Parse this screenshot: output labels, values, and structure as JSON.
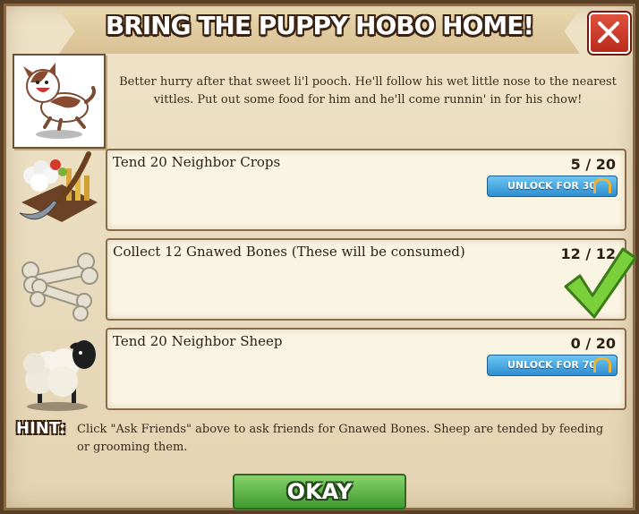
{
  "dialog": {
    "title": "BRING THE PUPPY HOBO HOME!",
    "intro": "Better hurry after that sweet li'l pooch.  He'll follow his wet little nose to the nearest vittles. Put out some food for him and he'll come runnin' in for his chow!",
    "close_icon": "close-x-icon"
  },
  "tasks": [
    {
      "label": "Tend 20 Neighbor Crops",
      "count": "5 / 20",
      "unlock_label": "UNLOCK FOR 30",
      "icon": "crops-scythe-icon",
      "complete": false
    },
    {
      "label": "Collect 12 Gnawed Bones (These will be consumed)",
      "count": "12 / 12",
      "unlock_label": "",
      "icon": "bones-icon",
      "complete": true
    },
    {
      "label": "Tend 20 Neighbor Sheep",
      "count": "0 / 20",
      "unlock_label": "UNLOCK FOR 70",
      "icon": "sheep-icon",
      "complete": false
    }
  ],
  "hint": {
    "tag": "HINT:",
    "text": "Click \"Ask Friends\" above to ask friends for Gnawed Bones. Sheep are tended by feeding or grooming them."
  },
  "okay_label": "OKAY",
  "colors": {
    "unlock": "#3a9be0",
    "okay": "#5cb844",
    "close": "#d03a2a",
    "check": "#7ad03a"
  }
}
